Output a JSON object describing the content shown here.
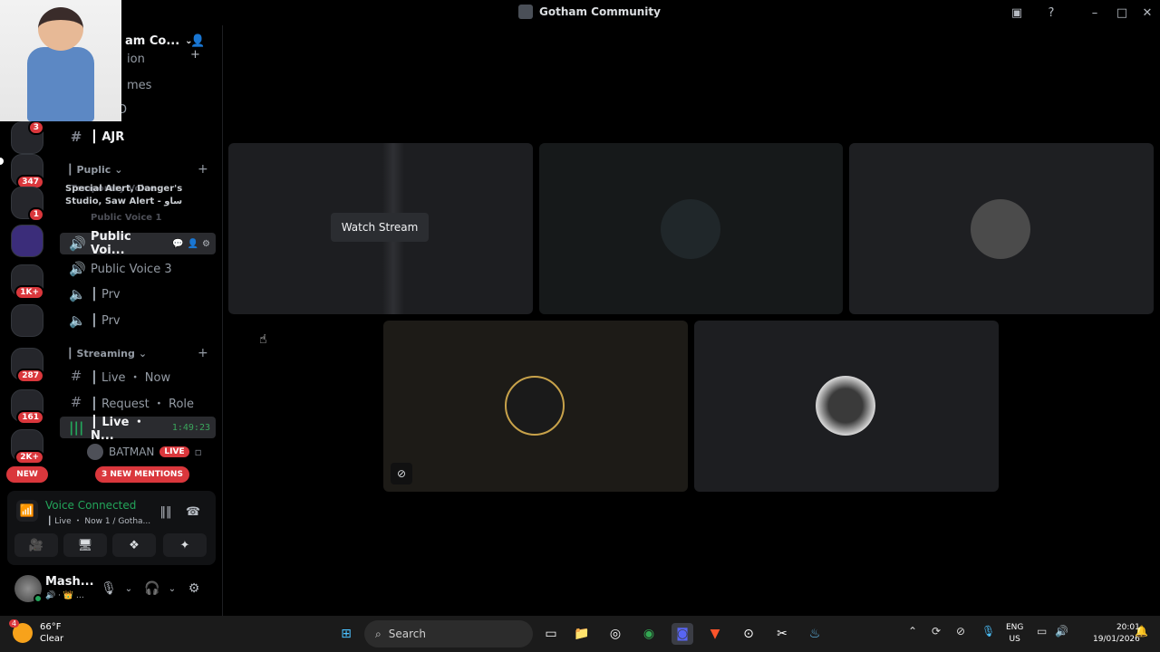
{
  "window": {
    "title": "Gotham Community"
  },
  "server": {
    "name": "am Co...",
    "new_pill": "NEW"
  },
  "server_badges": [
    "3",
    "347",
    "1",
    "1K+",
    "287",
    "161",
    "2K+"
  ],
  "channels": {
    "partial_top": [
      "ion",
      "mes",
      "D"
    ],
    "items": [
      {
        "label": "┃ AJR"
      },
      {
        "label": "Public Voi...",
        "active": true
      },
      {
        "label": "Public Voice 3"
      },
      {
        "label": "┃ Prv"
      },
      {
        "label": "┃ Prv"
      },
      {
        "label": "┃ Live ・ Now"
      },
      {
        "label": "┃ Request ・ Role"
      },
      {
        "label": "┃ Live ・ N...",
        "timer": "1:49:23"
      }
    ],
    "categories": [
      {
        "label": "┃ Puplic"
      },
      {
        "label": "┃ Streaming"
      }
    ],
    "hover_tooltip": "Special Alert, Danger's Studio, Saw Alert - ساو",
    "tooltip_behind": [
      "Temporary Voice",
      "Public Voice 1"
    ],
    "voice_user": {
      "name": "BATMAN",
      "badge": "LIVE"
    },
    "mentions": "3 NEW MENTIONS"
  },
  "voice_panel": {
    "title": "Voice Connected",
    "subtitle": "┃ Live ・ Now 1 / Gotha..."
  },
  "user": {
    "name": "Mash..."
  },
  "stage": {
    "watch_stream": "Watch Stream"
  },
  "taskbar": {
    "temp": "66°F",
    "condition": "Clear",
    "weather_badge": "4",
    "search": "Search",
    "lang_top": "ENG",
    "lang_bottom": "US",
    "time": "20:01",
    "date": "19/01/2026"
  }
}
